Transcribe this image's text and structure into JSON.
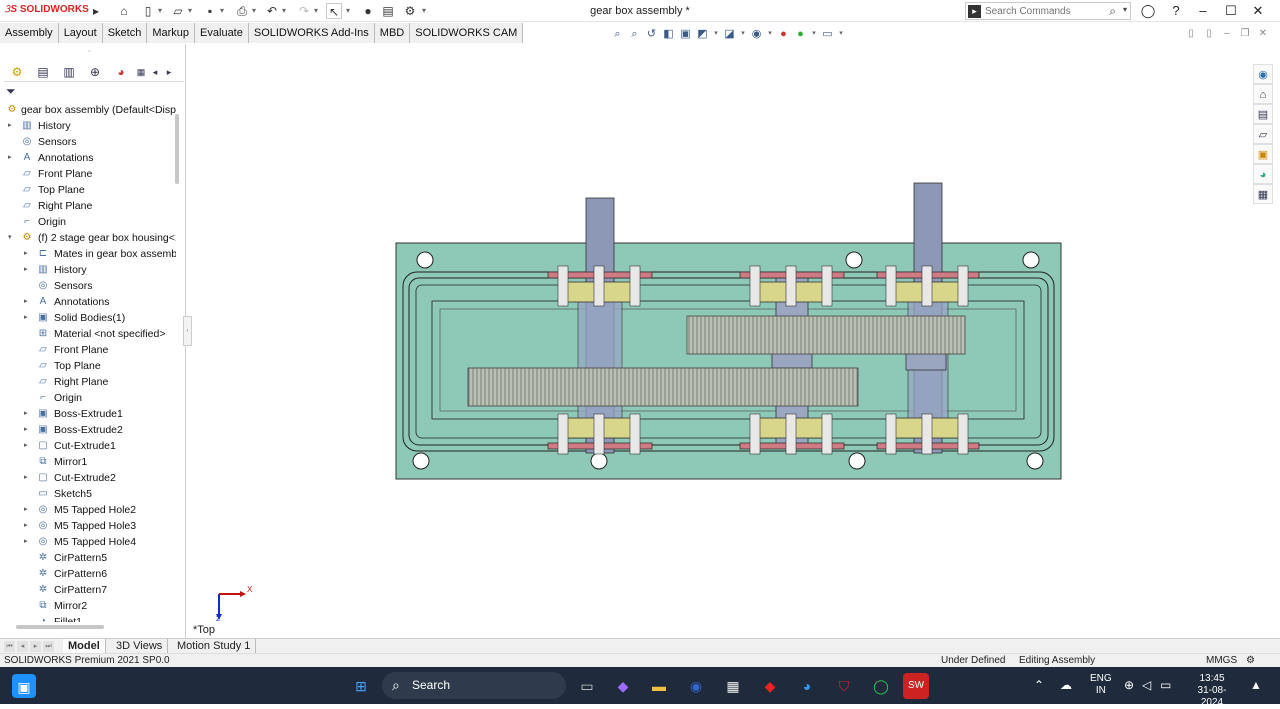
{
  "app": {
    "logo_text": "SOLIDWORKS",
    "window_title": "gear box assembly *"
  },
  "quick_toolbar": {
    "icons": [
      "menu-expand-icon",
      "home-icon",
      "new-document-icon",
      "open-icon",
      "save-icon",
      "print-icon",
      "undo-icon",
      "redo-icon",
      "select-icon",
      "rebuild-icon",
      "file-properties-icon",
      "options-icon"
    ]
  },
  "search": {
    "placeholder": "Search Commands"
  },
  "command_tabs": [
    "Assembly",
    "Layout",
    "Sketch",
    "Markup",
    "Evaluate",
    "SOLIDWORKS Add-Ins",
    "MBD",
    "SOLIDWORKS CAM"
  ],
  "feature_manager": {
    "tree": [
      {
        "label": "gear box assembly  (Default<Disp",
        "level": 0,
        "icon": "assembly-icon",
        "expander": ""
      },
      {
        "label": "History",
        "level": 1,
        "icon": "history-icon",
        "expander": "▸"
      },
      {
        "label": "Sensors",
        "level": 1,
        "icon": "sensors-icon",
        "expander": ""
      },
      {
        "label": "Annotations",
        "level": 1,
        "icon": "annotations-icon",
        "expander": "▸"
      },
      {
        "label": "Front Plane",
        "level": 1,
        "icon": "plane-icon",
        "expander": ""
      },
      {
        "label": "Top Plane",
        "level": 1,
        "icon": "plane-icon",
        "expander": ""
      },
      {
        "label": "Right Plane",
        "level": 1,
        "icon": "plane-icon",
        "expander": ""
      },
      {
        "label": "Origin",
        "level": 1,
        "icon": "origin-icon",
        "expander": ""
      },
      {
        "label": "(f) 2 stage gear box housing<1",
        "level": 1,
        "icon": "part-icon",
        "expander": "▾"
      },
      {
        "label": "Mates in gear box assembl",
        "level": 2,
        "icon": "mates-icon",
        "expander": "▸"
      },
      {
        "label": "History",
        "level": 2,
        "icon": "history-icon",
        "expander": "▸"
      },
      {
        "label": "Sensors",
        "level": 2,
        "icon": "sensors-icon",
        "expander": ""
      },
      {
        "label": "Annotations",
        "level": 2,
        "icon": "annotations-icon",
        "expander": "▸"
      },
      {
        "label": "Solid Bodies(1)",
        "level": 2,
        "icon": "solid-bodies-icon",
        "expander": "▸"
      },
      {
        "label": "Material <not specified>",
        "level": 2,
        "icon": "material-icon",
        "expander": ""
      },
      {
        "label": "Front Plane",
        "level": 2,
        "icon": "plane-icon",
        "expander": ""
      },
      {
        "label": "Top Plane",
        "level": 2,
        "icon": "plane-icon",
        "expander": ""
      },
      {
        "label": "Right Plane",
        "level": 2,
        "icon": "plane-icon",
        "expander": ""
      },
      {
        "label": "Origin",
        "level": 2,
        "icon": "origin-icon",
        "expander": ""
      },
      {
        "label": "Boss-Extrude1",
        "level": 2,
        "icon": "extrude-icon",
        "expander": "▸"
      },
      {
        "label": "Boss-Extrude2",
        "level": 2,
        "icon": "extrude-icon",
        "expander": "▸"
      },
      {
        "label": "Cut-Extrude1",
        "level": 2,
        "icon": "cut-extrude-icon",
        "expander": "▸"
      },
      {
        "label": "Mirror1",
        "level": 2,
        "icon": "mirror-icon",
        "expander": ""
      },
      {
        "label": "Cut-Extrude2",
        "level": 2,
        "icon": "cut-extrude-icon",
        "expander": "▸"
      },
      {
        "label": "Sketch5",
        "level": 2,
        "icon": "sketch-icon",
        "expander": ""
      },
      {
        "label": "M5 Tapped Hole2",
        "level": 2,
        "icon": "hole-icon",
        "expander": "▸"
      },
      {
        "label": "M5 Tapped Hole3",
        "level": 2,
        "icon": "hole-icon",
        "expander": "▸"
      },
      {
        "label": "M5 Tapped Hole4",
        "level": 2,
        "icon": "hole-icon",
        "expander": "▸"
      },
      {
        "label": "CirPattern5",
        "level": 2,
        "icon": "circular-pattern-icon",
        "expander": ""
      },
      {
        "label": "CirPattern6",
        "level": 2,
        "icon": "circular-pattern-icon",
        "expander": ""
      },
      {
        "label": "CirPattern7",
        "level": 2,
        "icon": "circular-pattern-icon",
        "expander": ""
      },
      {
        "label": "Mirror2",
        "level": 2,
        "icon": "mirror-icon",
        "expander": ""
      },
      {
        "label": "Fillet1",
        "level": 2,
        "icon": "fillet-icon",
        "expander": ""
      }
    ]
  },
  "viewport": {
    "view_name": "*Top",
    "triad_x": "X",
    "triad_z": "Z"
  },
  "bottom_tabs": [
    "Model",
    "3D Views",
    "Motion Study 1"
  ],
  "status_bar": {
    "product": "SOLIDWORKS Premium 2021 SP0.0",
    "state1": "Under Defined",
    "state2": "Editing Assembly",
    "units": "MMGS"
  },
  "taskbar": {
    "search_label": "Search",
    "lang_line1": "ENG",
    "lang_line2": "IN",
    "time": "13:45",
    "date": "31-08-2024"
  },
  "colors": {
    "housing": "#8ec8b6",
    "flange": "#d07a84",
    "bearing": "#d8d68a",
    "shaft": "#8d97b6",
    "gear": "#c9cec0",
    "taskbar": "#1f2b3c"
  }
}
